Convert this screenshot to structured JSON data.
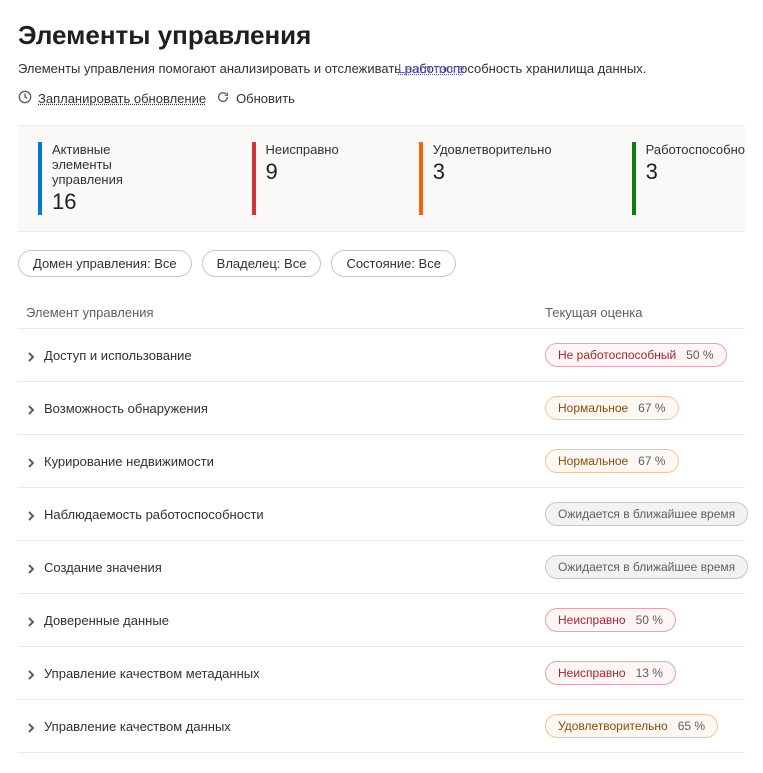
{
  "page": {
    "title": "Элементы управления",
    "subtitle": "Элементы управления помогают анализировать и отслеживать работоспособность хранилища данных.",
    "learn_more": "Learn more"
  },
  "toolbar": {
    "schedule_label": "Запланировать обновление",
    "refresh_label": "Обновить"
  },
  "stats": {
    "active": {
      "label": "Активные элементы управления",
      "value": "16"
    },
    "unhealthy": {
      "label": "Неисправно",
      "value": "9"
    },
    "fair": {
      "label": "Удовлетворительно",
      "value": "3"
    },
    "healthy": {
      "label": "Работоспособно",
      "value": "3"
    }
  },
  "filters": {
    "domain": "Домен управления: Все",
    "owner": "Владелец: Все",
    "status": "Состояние: Все"
  },
  "table": {
    "header_control": "Элемент управления",
    "header_score": "Текущая оценка",
    "rows": [
      {
        "name": "Доступ и использование",
        "badge_class": "unhealthy-badge",
        "status": "Не работоспособный",
        "pct": "50 %"
      },
      {
        "name": "Возможность обнаружения",
        "badge_class": "fair-badge",
        "status": "Нормальное",
        "pct": "67 %"
      },
      {
        "name": "Курирование недвижимости",
        "badge_class": "fair-badge",
        "status": "Нормальное",
        "pct": "67 %"
      },
      {
        "name": "Наблюдаемость работоспособности",
        "badge_class": "coming",
        "status": "Ожидается в ближайшее время",
        "pct": ""
      },
      {
        "name": "Создание значения",
        "badge_class": "coming",
        "status": "Ожидается в ближайшее время",
        "pct": ""
      },
      {
        "name": "Доверенные данные",
        "badge_class": "unhealthy-badge",
        "status": "Неисправно",
        "pct": "50 %"
      },
      {
        "name": "Управление качеством метаданных",
        "badge_class": "unhealthy-badge",
        "status": "Неисправно",
        "pct": "13 %"
      },
      {
        "name": "Управление качеством данных",
        "badge_class": "fair-badge",
        "status": "Удовлетворительно",
        "pct": "65 %"
      }
    ]
  }
}
